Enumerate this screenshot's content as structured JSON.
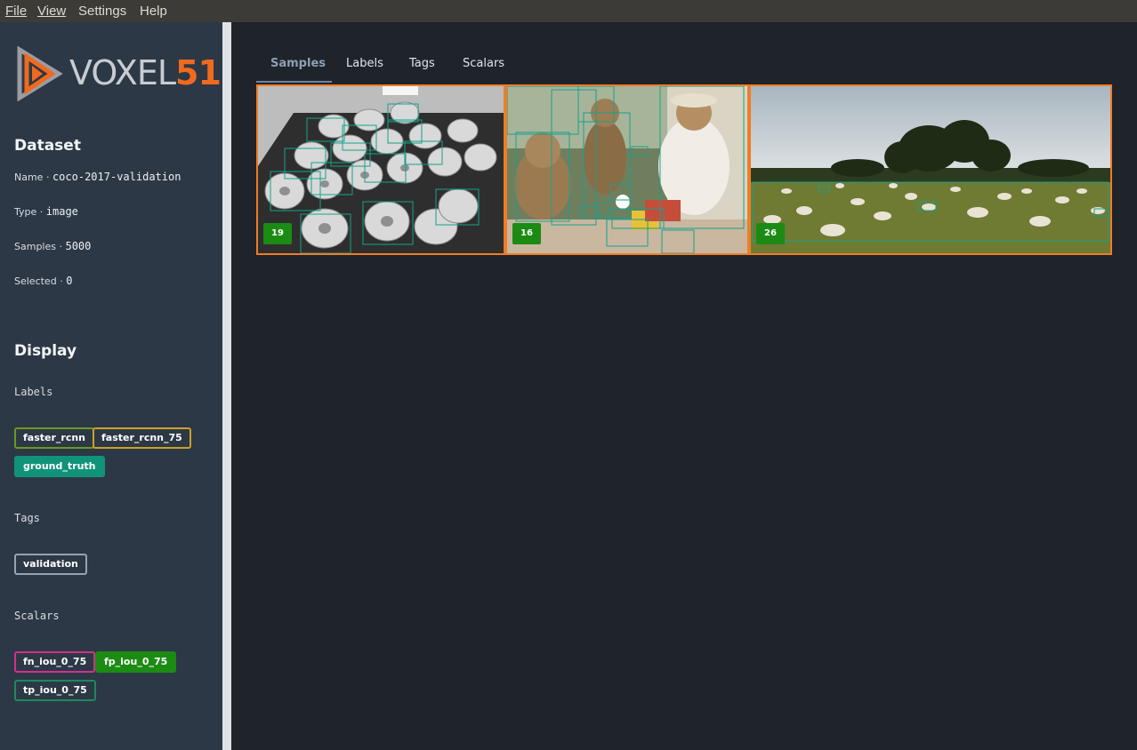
{
  "menu": {
    "file": "File",
    "view": "View",
    "settings": "Settings",
    "help": "Help"
  },
  "logo": {
    "text_a": "VOXEL",
    "text_b": "51"
  },
  "dataset": {
    "heading": "Dataset",
    "name_label": "Name",
    "name_value": "coco-2017-validation",
    "type_label": "Type",
    "type_value": "image",
    "samples_label": "Samples",
    "samples_value": "5000",
    "selected_label": "Selected",
    "selected_value": "0",
    "sep": "·"
  },
  "display": {
    "heading": "Display",
    "labels_title": "Labels",
    "labels": [
      {
        "text": "faster_rcnn",
        "color": "#6a9a1f"
      },
      {
        "text": "faster_rcnn_75",
        "color": "#c9a227"
      },
      {
        "text": "ground_truth",
        "color": "#11937a"
      }
    ],
    "tags_title": "Tags",
    "tags": [
      {
        "text": "validation",
        "color": "#9aa3ad"
      }
    ],
    "scalars_title": "Scalars",
    "scalars": [
      {
        "text": "fn_iou_0_75",
        "color": "#d1308e"
      },
      {
        "text": "fp_iou_0_75",
        "color": "#1b8b14"
      },
      {
        "text": "tp_iou_0_75",
        "color": "#1d8a5c"
      }
    ]
  },
  "tabs": [
    "Samples",
    "Labels",
    "Tags",
    "Scalars"
  ],
  "active_tab": "Samples",
  "samples": [
    {
      "count": "19",
      "subject": "donuts"
    },
    {
      "count": "16",
      "subject": "teddy-bears"
    },
    {
      "count": "26",
      "subject": "sheep-field"
    }
  ],
  "colors": {
    "accent": "#ef7d27",
    "box": "#17a18a",
    "count_badge": "#1b8b14"
  }
}
